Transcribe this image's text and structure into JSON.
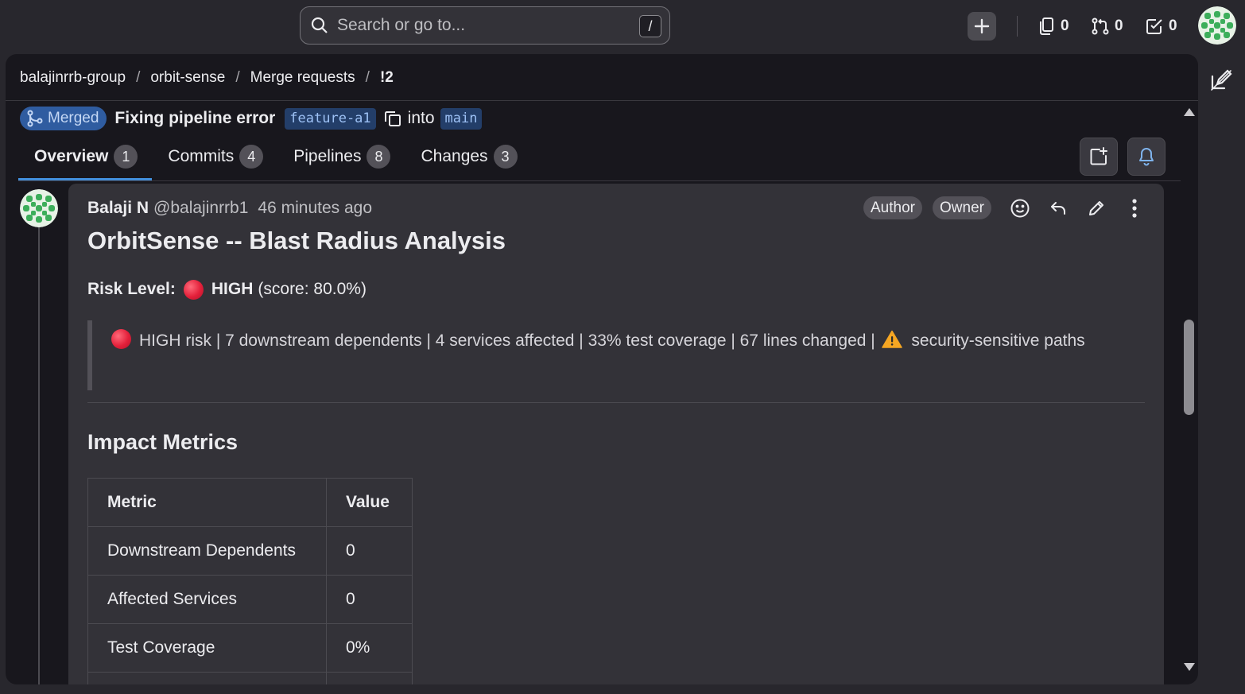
{
  "topbar": {
    "search_placeholder": "Search or go to...",
    "search_shortcut": "/",
    "issues_count": "0",
    "merge_requests_count": "0",
    "todos_count": "0"
  },
  "breadcrumb": {
    "items": [
      "balajinrrb-group",
      "orbit-sense",
      "Merge requests",
      "!2"
    ],
    "separator": "/"
  },
  "mr": {
    "status": "Merged",
    "title": "Fixing pipeline error",
    "source_branch": "feature-a1",
    "into_label": "into",
    "target_branch": "main"
  },
  "tabs": [
    {
      "label": "Overview",
      "count": "1"
    },
    {
      "label": "Commits",
      "count": "4"
    },
    {
      "label": "Pipelines",
      "count": "8"
    },
    {
      "label": "Changes",
      "count": "3"
    }
  ],
  "note": {
    "author_name": "Balaji N",
    "author_handle": "@balajinrrb1",
    "time": "46 minutes ago",
    "badges": [
      "Author",
      "Owner"
    ],
    "heading": "OrbitSense -- Blast Radius Analysis",
    "risk_label": "Risk Level:",
    "risk_value": "HIGH",
    "risk_score": "(score: 80.0%)",
    "summary_prefix": "HIGH risk | 7 downstream dependents | 4 services affected | 33% test coverage | 67 lines changed |",
    "summary_suffix": "security-sensitive paths",
    "section_heading": "Impact Metrics",
    "table": {
      "headers": [
        "Metric",
        "Value"
      ],
      "rows": [
        [
          "Downstream Dependents",
          "0"
        ],
        [
          "Affected Services",
          "0"
        ],
        [
          "Test Coverage",
          "0%"
        ]
      ]
    }
  },
  "colors": {
    "merged_badge": "#2f5ca0",
    "active_tab_underline": "#428fdc",
    "risk_dot": "#e3203a",
    "warning": "#f5a623"
  }
}
